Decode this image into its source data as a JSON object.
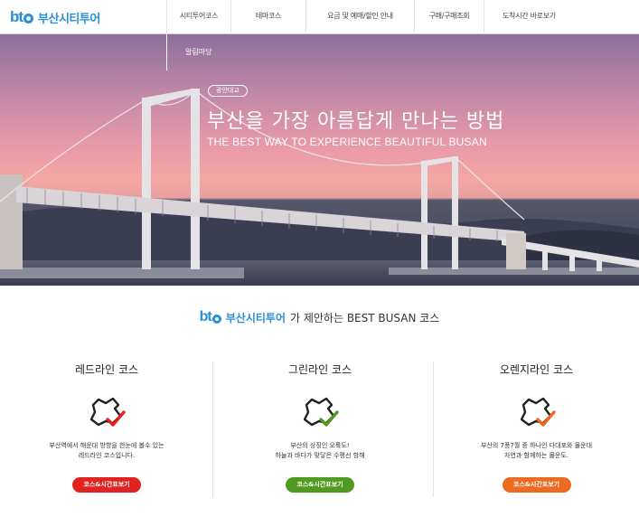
{
  "header": {
    "logo_text": "bt",
    "logo_name": "부산시티투어",
    "nav": [
      "시티투어코스",
      "테마코스",
      "요금 및 예매/할인 안내",
      "구매/구매조회",
      "도착시간 바로보기"
    ],
    "submenu_item": "알림마당"
  },
  "hero": {
    "badge": "광안대교",
    "title": "부산을 가장 아름답게 만나는 방법",
    "subtitle": "THE BEST WAY TO EXPERIENCE BEAUTIFUL BUSAN"
  },
  "intro": {
    "logo_text": "bt",
    "brand": "부산시티투어",
    "rest": "가 제안하는 BEST BUSAN 코스"
  },
  "courses": [
    {
      "title": "레드라인 코스",
      "desc1": "부산역에서 해운대 방향을 한눈에 볼수 있는",
      "desc2": "레드라인 코스입니다.",
      "button": "코스&시간표보기",
      "color": "#e0231f"
    },
    {
      "title": "그린라인 코스",
      "desc1": "부산의 상징인 오륙도!",
      "desc2": "하늘과 바다가 맞닿은 수평선 항해",
      "button": "코스&시간표보기",
      "color": "#4f9a1f"
    },
    {
      "title": "오렌지라인 코스",
      "desc1": "부산의 7풍7월 중 하나인 다대포와 몰운대",
      "desc2": "자연과 함께하는 몰운도.",
      "button": "코스&시간표보기",
      "color": "#ee6a22"
    }
  ]
}
